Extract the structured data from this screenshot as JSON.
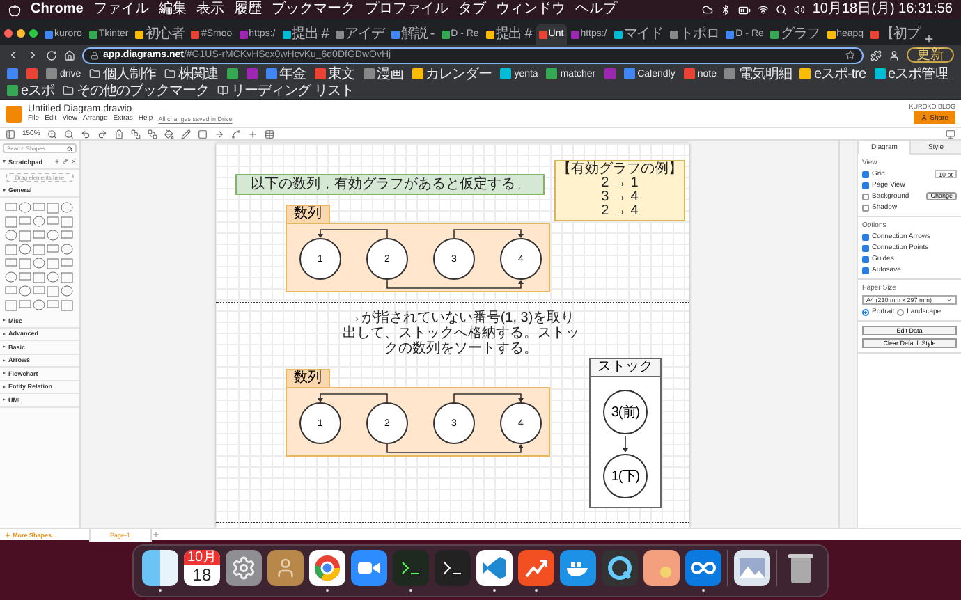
{
  "menu_bar": {
    "app": "Chrome",
    "items": [
      "ファイル",
      "編集",
      "表示",
      "履歴",
      "ブックマーク",
      "プロファイル",
      "タブ",
      "ウィンドウ",
      "ヘルプ"
    ],
    "clock": "10月18日(月) 16:31:56"
  },
  "tabs": [
    {
      "title": "kuroro",
      "selected": false
    },
    {
      "title": "Tkinter",
      "selected": false
    },
    {
      "title": "初心者",
      "selected": false
    },
    {
      "title": "#Smoo",
      "selected": false
    },
    {
      "title": "https:/",
      "selected": false
    },
    {
      "title": "提出 #",
      "selected": false
    },
    {
      "title": "アイデ",
      "selected": false
    },
    {
      "title": "解説 -",
      "selected": false
    },
    {
      "title": "D - Re",
      "selected": false
    },
    {
      "title": "提出 #",
      "selected": false
    },
    {
      "title": "Unt",
      "selected": true
    },
    {
      "title": "https:/",
      "selected": false
    },
    {
      "title": "マイド",
      "selected": false
    },
    {
      "title": "トポロ",
      "selected": false
    },
    {
      "title": "D - Re",
      "selected": false
    },
    {
      "title": "グラフ",
      "selected": false
    },
    {
      "title": "heapq",
      "selected": false
    },
    {
      "title": "【初プ",
      "selected": false
    }
  ],
  "address_bar": {
    "host": "app.diagrams.net",
    "path": "/#G1US-rMCKvHScx0wHcvKu_6d0DfGDwOvHj",
    "update_button": "更新"
  },
  "bookmarks": [
    {
      "kind": "icon"
    },
    {
      "kind": "icon"
    },
    {
      "kind": "link",
      "label": "drive"
    },
    {
      "kind": "folder",
      "label": "個人制作"
    },
    {
      "kind": "folder",
      "label": "株関連"
    },
    {
      "kind": "icon"
    },
    {
      "kind": "icon"
    },
    {
      "kind": "link",
      "label": "年金"
    },
    {
      "kind": "link",
      "label": "東文"
    },
    {
      "kind": "link",
      "label": "漫画"
    },
    {
      "kind": "link",
      "label": "カレンダー"
    },
    {
      "kind": "link",
      "label": "yenta"
    },
    {
      "kind": "link",
      "label": "matcher"
    },
    {
      "kind": "icon"
    },
    {
      "kind": "link",
      "label": "Calendly"
    },
    {
      "kind": "link",
      "label": "note"
    },
    {
      "kind": "link",
      "label": "電気明細"
    },
    {
      "kind": "link",
      "label": "eスポ-tre"
    },
    {
      "kind": "link",
      "label": "eスポ管理"
    },
    {
      "kind": "link",
      "label": "eスポ"
    },
    {
      "kind": "folder",
      "label": "その他のブックマーク"
    },
    {
      "kind": "reading",
      "label": "リーディング リスト"
    }
  ],
  "drawio": {
    "title": "Untitled Diagram.drawio",
    "menus": [
      "File",
      "Edit",
      "View",
      "Arrange",
      "Extras",
      "Help"
    ],
    "save_status": "All changes saved in Drive",
    "account": "KUROKO BLOG",
    "share_button": "Share",
    "zoom": "150%"
  },
  "sidebar": {
    "search_placeholder": "Search Shapes",
    "scratchpad_title": "Scratchpad",
    "scratchpad_hint": "Drag elements here",
    "sections": [
      {
        "title": "General",
        "expanded": true
      },
      {
        "title": "Misc",
        "expanded": false
      },
      {
        "title": "Advanced",
        "expanded": false
      },
      {
        "title": "Basic",
        "expanded": false
      },
      {
        "title": "Arrows",
        "expanded": false
      },
      {
        "title": "Flowchart",
        "expanded": false
      },
      {
        "title": "Entity Relation",
        "expanded": false
      },
      {
        "title": "UML",
        "expanded": false
      }
    ],
    "more_shapes": "More Shapes..."
  },
  "diagram": {
    "assumption": "以下の数列，有効グラフがあると仮定する。",
    "example_note": [
      "【有効グラフの例】",
      "2 → 1",
      "3 → 4",
      "2 → 4"
    ],
    "description": "→が指されていない番号(1, 3)を取り出して、ストックへ格納する。ストックの数列をソートする。",
    "groups": [
      {
        "label": "数列",
        "nodes": [
          "1",
          "2",
          "3",
          "4"
        ]
      },
      {
        "label": "数列",
        "nodes": [
          "1",
          "2",
          "3",
          "4"
        ]
      }
    ],
    "stack": {
      "label": "ストック",
      "nodes": [
        "3(前)",
        "1(下)"
      ]
    }
  },
  "page_tabs": [
    {
      "label": "Page-1",
      "selected": true
    }
  ],
  "format_panel": {
    "tabs": [
      {
        "label": "Diagram",
        "selected": true
      },
      {
        "label": "Style",
        "selected": false
      }
    ],
    "view_title": "View",
    "view_options": [
      {
        "label": "Grid",
        "checked": true,
        "value": "10 pt"
      },
      {
        "label": "Page View",
        "checked": true
      },
      {
        "label": "Background",
        "checked": false,
        "button": "Change"
      },
      {
        "label": "Shadow",
        "checked": false
      }
    ],
    "options_title": "Options",
    "options": [
      {
        "label": "Connection Arrows",
        "checked": true
      },
      {
        "label": "Connection Points",
        "checked": true
      },
      {
        "label": "Guides",
        "checked": true
      },
      {
        "label": "Autosave",
        "checked": true
      }
    ],
    "paper_title": "Paper Size",
    "paper_size": "A4 (210 mm x 297 mm)",
    "orientations": [
      {
        "label": "Portrait",
        "selected": true
      },
      {
        "label": "Landscape",
        "selected": false
      }
    ],
    "buttons": [
      "Edit Data",
      "Clear Default Style"
    ]
  },
  "dock": {
    "calendar_month": "10月",
    "calendar_day": "18",
    "apps": [
      {
        "kind": "finder",
        "running": true
      },
      {
        "kind": "calendar",
        "running": false
      },
      {
        "kind": "settings",
        "running": false
      },
      {
        "kind": "contacts",
        "running": false
      },
      {
        "kind": "chrome",
        "running": true
      },
      {
        "kind": "video",
        "running": false
      },
      {
        "kind": "console",
        "running": true
      },
      {
        "kind": "terminal",
        "running": false
      },
      {
        "kind": "code",
        "running": true
      },
      {
        "kind": "chart",
        "running": true
      },
      {
        "kind": "whale",
        "running": false
      },
      {
        "kind": "quicktime",
        "running": false
      },
      {
        "kind": "preview",
        "running": false
      },
      {
        "kind": "infinity",
        "running": true
      },
      {
        "kind": "photo",
        "running": false
      },
      {
        "kind": "trash",
        "running": false
      }
    ]
  }
}
